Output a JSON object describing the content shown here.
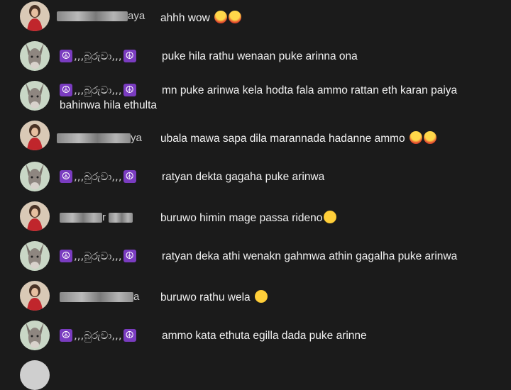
{
  "comments": [
    {
      "user_type": "female",
      "name_suffix": "aya",
      "text": "ahhh wow",
      "emojis": [
        "astonished-emoji",
        "astonished-emoji"
      ]
    },
    {
      "user_type": "donkey",
      "name_mid": ",,,බුරුවා,,,",
      "text": "puke hila rathu wenaan puke arinna ona",
      "emojis": []
    },
    {
      "user_type": "donkey",
      "name_mid": ",,,බුරුවා,,,",
      "text": "mn puke arinwa kela hodta fala ammo rattan eth karan paiya",
      "text2": "bahinwa hila ethulta",
      "emojis": []
    },
    {
      "user_type": "female",
      "name_suffix": "ya",
      "text": "ubala mawa sapa dila marannada hadanne ammo",
      "emojis": [
        "astonished-emoji",
        "astonished-emoji"
      ]
    },
    {
      "user_type": "donkey",
      "name_mid": ",,,බුරුවා,,,",
      "text": "ratyan dekta gagaha puke arinwa",
      "emojis": []
    },
    {
      "user_type": "female",
      "name_suffix": "r",
      "text": "buruwo himin mage passa rideno",
      "emojis": [
        "shushing-emoji"
      ]
    },
    {
      "user_type": "donkey",
      "name_mid": ",,,බුරුවා,,,",
      "text": "ratyan deka athi wenakn gahmwa athin gagalha puke arinwa",
      "emojis": []
    },
    {
      "user_type": "female",
      "name_suffix": "a",
      "text": "buruwo rathu wela",
      "emojis": [
        "shushing-emoji"
      ]
    },
    {
      "user_type": "donkey",
      "name_mid": ",,,බුරුවා,,,",
      "text": "ammo kata ethuta egilla dada puke arinne",
      "emojis": []
    }
  ],
  "icons": {
    "peace": "☮"
  }
}
